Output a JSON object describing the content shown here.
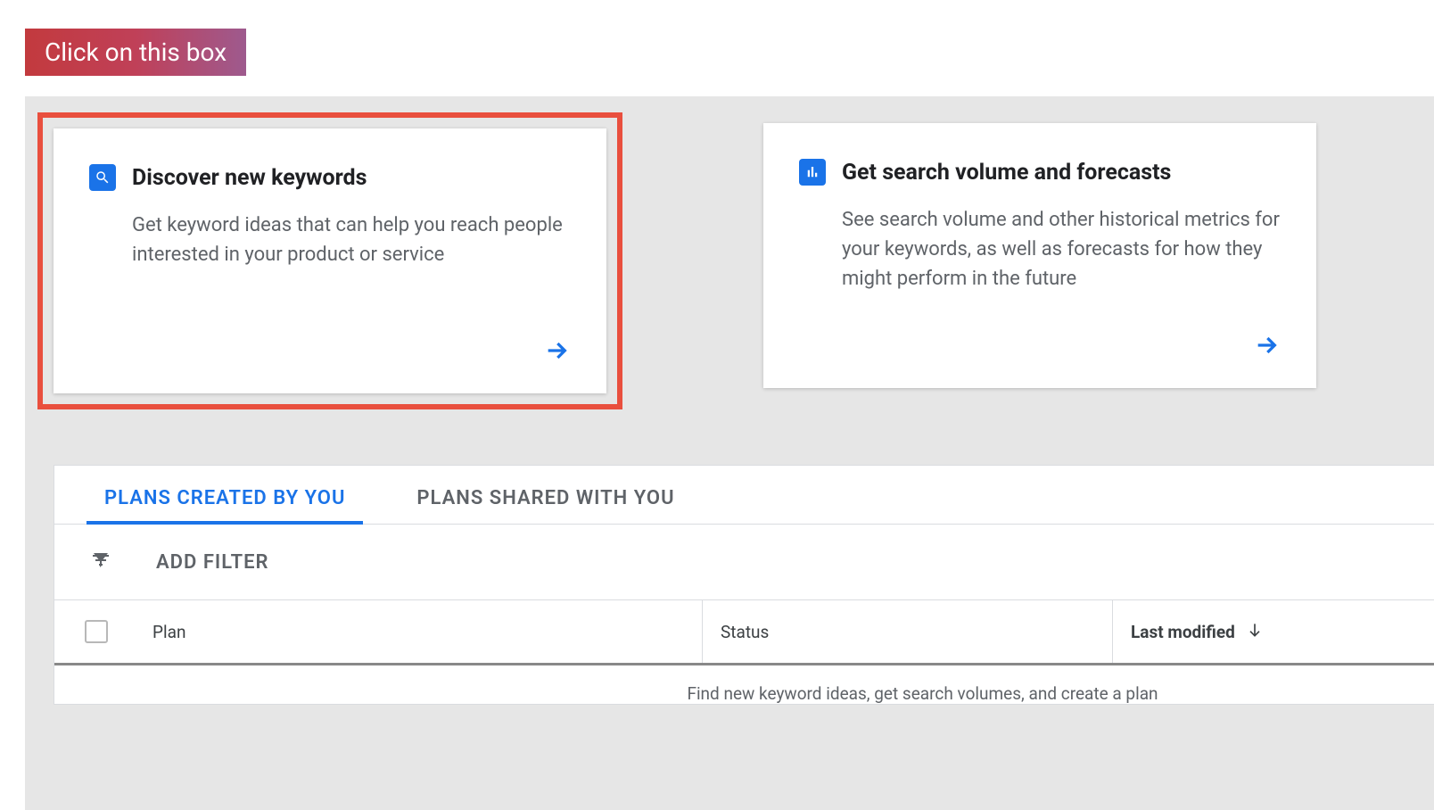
{
  "callout": {
    "text": "Click on this box"
  },
  "cards": {
    "discover": {
      "title": "Discover new keywords",
      "description": "Get keyword ideas that can help you reach people interested in your product or service"
    },
    "forecasts": {
      "title": "Get search volume and forecasts",
      "description": "See search volume and other historical metrics for your keywords, as well as forecasts for how they might perform in the future"
    }
  },
  "tabs": {
    "created": "PLANS CREATED BY YOU",
    "shared": "PLANS SHARED WITH YOU"
  },
  "filter": {
    "add_label": "ADD FILTER"
  },
  "table": {
    "headers": {
      "plan": "Plan",
      "status": "Status",
      "last_modified": "Last modified"
    }
  },
  "hint": "Find new keyword ideas, get search volumes, and create a plan"
}
